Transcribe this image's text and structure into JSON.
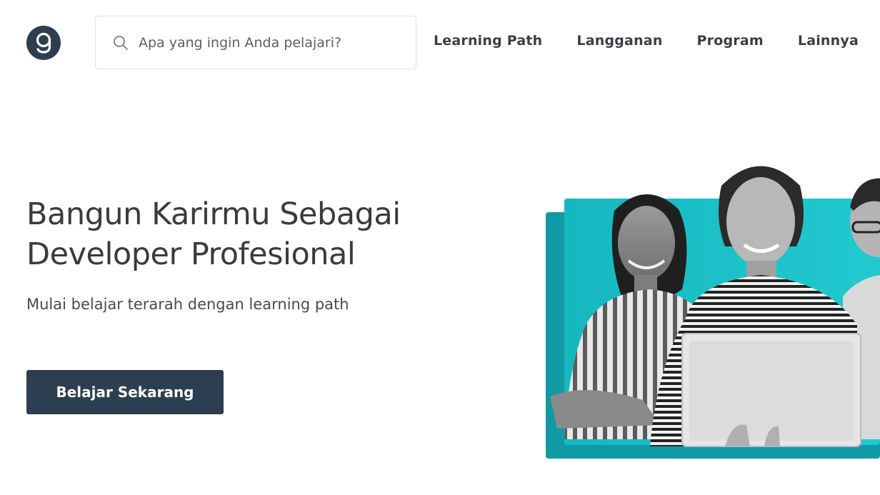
{
  "header": {
    "logo": {
      "icon": "dicoding-logo-icon",
      "color": "#2d3e50"
    },
    "search": {
      "placeholder": "Apa yang ingin Anda pelajari?",
      "value": "",
      "icon": "search-icon"
    },
    "nav": [
      {
        "label": "Learning Path"
      },
      {
        "label": "Langganan"
      },
      {
        "label": "Program"
      },
      {
        "label": "Lainnya"
      }
    ]
  },
  "hero": {
    "title_line1": "Bangun Karirmu Sebagai",
    "title_line2": "Developer Profesional",
    "subtitle": "Mulai belajar terarah dengan learning path",
    "cta_label": "Belajar Sekarang",
    "accent_color": "#17c2c9",
    "cta_color": "#2d3e50",
    "image": "hero-students-image"
  }
}
